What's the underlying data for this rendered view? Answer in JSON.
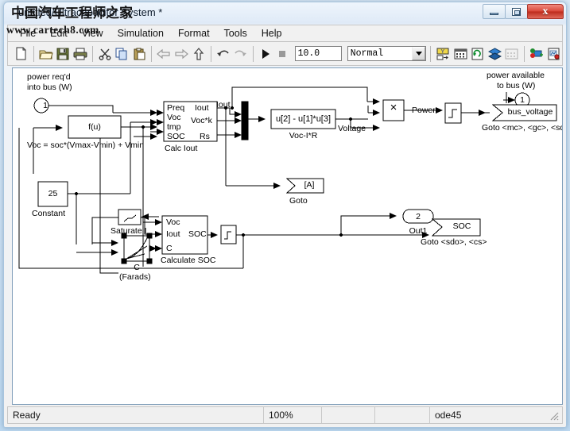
{
  "window": {
    "title": "untitled/Ultracapacitor System *",
    "buttons": {
      "minimize": "Minimize",
      "restore": "Restore",
      "close": "x"
    }
  },
  "watermark": {
    "chinese": "中国汽车工程师之家",
    "url": "www.cartech8.com"
  },
  "menu": {
    "items": [
      {
        "label": "File"
      },
      {
        "label": "Edit"
      },
      {
        "label": "View"
      },
      {
        "label": "Simulation"
      },
      {
        "label": "Format"
      },
      {
        "label": "Tools"
      },
      {
        "label": "Help"
      }
    ]
  },
  "toolbar": {
    "sim_time": "10.0",
    "sim_mode": "Normal",
    "buttons": [
      {
        "name": "new-model-button",
        "icon": "new-file-icon"
      },
      {
        "name": "open-model-button",
        "icon": "open-folder-icon"
      },
      {
        "name": "save-model-button",
        "icon": "floppy-disk-icon"
      },
      {
        "name": "print-button",
        "icon": "printer-icon"
      },
      {
        "name": "cut-button",
        "icon": "scissors-icon"
      },
      {
        "name": "copy-button",
        "icon": "copy-icon"
      },
      {
        "name": "paste-button",
        "icon": "clipboard-icon"
      },
      {
        "name": "back-button",
        "icon": "arrow-left-icon"
      },
      {
        "name": "forward-button",
        "icon": "arrow-right-icon"
      },
      {
        "name": "up-level-button",
        "icon": "arrow-up-icon"
      },
      {
        "name": "undo-button",
        "icon": "undo-icon"
      },
      {
        "name": "redo-button",
        "icon": "redo-icon"
      },
      {
        "name": "start-simulation-button",
        "icon": "play-icon"
      },
      {
        "name": "stop-simulation-button",
        "icon": "stop-icon"
      },
      {
        "name": "library-browser-button",
        "icon": "library-icon"
      },
      {
        "name": "toggle-model-browser-button",
        "icon": "model-browser-icon"
      },
      {
        "name": "update-diagram-button",
        "icon": "refresh-diagram-icon"
      },
      {
        "name": "debug-button",
        "icon": "debug-layers-icon"
      },
      {
        "name": "build-button",
        "icon": "build-icon"
      },
      {
        "name": "model-explorer-button",
        "icon": "model-explorer-icon"
      },
      {
        "name": "report-button",
        "icon": "report-icon"
      }
    ]
  },
  "statusbar": {
    "status": "Ready",
    "zoom": "100%",
    "pane3": "",
    "pane4": "",
    "solver": "ode45"
  },
  "model": {
    "annotations": [
      {
        "id": "power-req",
        "text_line1": "power req'd",
        "text_line2": "into bus (W)"
      },
      {
        "id": "power-avail",
        "text_line1": "power available",
        "text_line2": "to bus (W)"
      },
      {
        "id": "voc-equation",
        "text": "Voc = soc*(Vmax-Vmin) + Vmin"
      },
      {
        "id": "farads-note",
        "text": "(Farads)"
      }
    ],
    "blocks": [
      {
        "id": "in1",
        "type": "inport",
        "label": "1",
        "caption": ""
      },
      {
        "id": "fcn-fu",
        "type": "fcn",
        "label": "f(u)",
        "caption": ""
      },
      {
        "id": "calc-iout",
        "type": "subsystem",
        "label": "Calc Iout",
        "inputs": [
          "Preq",
          "Voc",
          "tmp",
          "SOC"
        ],
        "outputs": [
          "Iout",
          "Voc*k",
          "Rs"
        ]
      },
      {
        "id": "mux1",
        "type": "mux",
        "label": "",
        "caption": ""
      },
      {
        "id": "fcn-vocir",
        "type": "fcn",
        "label": "u[2] - u[1]*u[3]",
        "caption": "Voc-I*R"
      },
      {
        "id": "product1",
        "type": "product",
        "label": "×",
        "caption": ""
      },
      {
        "id": "memory1",
        "type": "memory",
        "label": "",
        "caption": ""
      },
      {
        "id": "goto-busvoltage",
        "type": "goto",
        "label": "bus_voltage",
        "caption": "Goto <mc>, <gc>, <sdo>"
      },
      {
        "id": "out1-power",
        "type": "outport",
        "label": "1",
        "caption": ""
      },
      {
        "id": "goto-a",
        "type": "goto",
        "label": "[A]",
        "caption": "Goto"
      },
      {
        "id": "constant25",
        "type": "constant",
        "label": "25",
        "caption": "Constant"
      },
      {
        "id": "saturate-i",
        "type": "saturation",
        "label": "",
        "caption": "Saturate I"
      },
      {
        "id": "lookup-c",
        "type": "lookup2d",
        "label": "",
        "caption": "C"
      },
      {
        "id": "calculate-soc",
        "type": "subsystem",
        "label": "Calculate SOC",
        "inputs": [
          "Voc",
          "Iout",
          "C"
        ],
        "outputs": [
          "SOC"
        ]
      },
      {
        "id": "memory2",
        "type": "memory",
        "label": "",
        "caption": ""
      },
      {
        "id": "out2",
        "type": "outport",
        "label": "2",
        "caption": "Out1"
      },
      {
        "id": "goto-soc",
        "type": "goto",
        "label": "SOC",
        "caption": "Goto <sdo>, <cs>"
      }
    ],
    "signal_labels": [
      {
        "id": "sig-iout",
        "text": "Iout"
      },
      {
        "id": "sig-voltage",
        "text": "Voltage"
      },
      {
        "id": "sig-power",
        "text": "Power"
      }
    ]
  },
  "colors": {
    "line": "#000000",
    "block_fill": "#ffffff",
    "canvas": "#ffffff",
    "close_button": "#d9493a",
    "titlebar_top": "#eef5fc"
  }
}
